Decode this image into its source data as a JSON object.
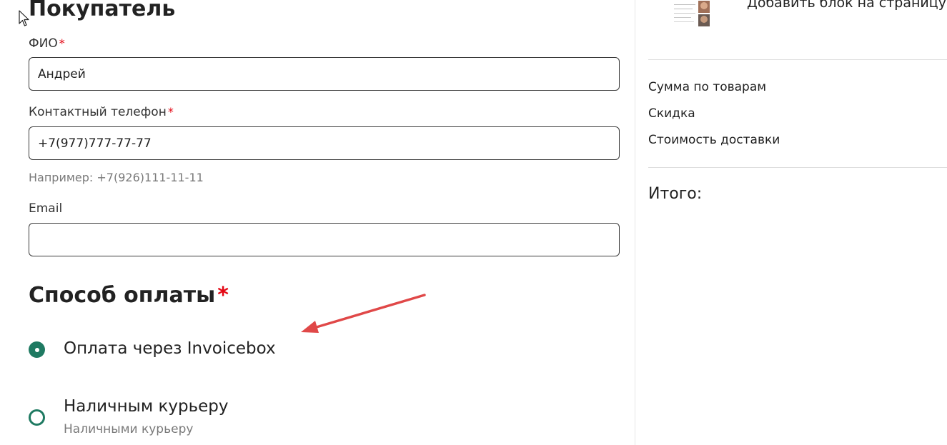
{
  "buyer": {
    "title": "Покупатель",
    "name_label": "ФИО",
    "name_value": "Андрей",
    "phone_label": "Контактный телефон",
    "phone_value": "+7(977)777-77-77",
    "phone_hint": "Например: +7(926)111-11-11",
    "email_label": "Email",
    "email_value": "",
    "required_mark": "*"
  },
  "payment": {
    "title": "Способ оплаты",
    "required_mark": "*",
    "options": [
      {
        "label": "Оплата через Invoicebox",
        "selected": true
      },
      {
        "label": "Наличным курьеру",
        "description": "Наличными курьеру",
        "selected": false
      }
    ]
  },
  "summary": {
    "add_block_label": "Добавить блок на страницу",
    "rows": [
      "Сумма по товарам",
      "Скидка",
      "Стоимость доставки"
    ],
    "total_label": "Итого:"
  },
  "colors": {
    "accent": "#1f7a62",
    "required": "#e30613",
    "annotation_arrow": "#e04848",
    "hint_text": "#7a7a7a"
  },
  "icons": {
    "cursor": "mouse-pointer-icon",
    "radio_checked": "radio-checked-icon",
    "radio_unchecked": "radio-unchecked-icon"
  }
}
